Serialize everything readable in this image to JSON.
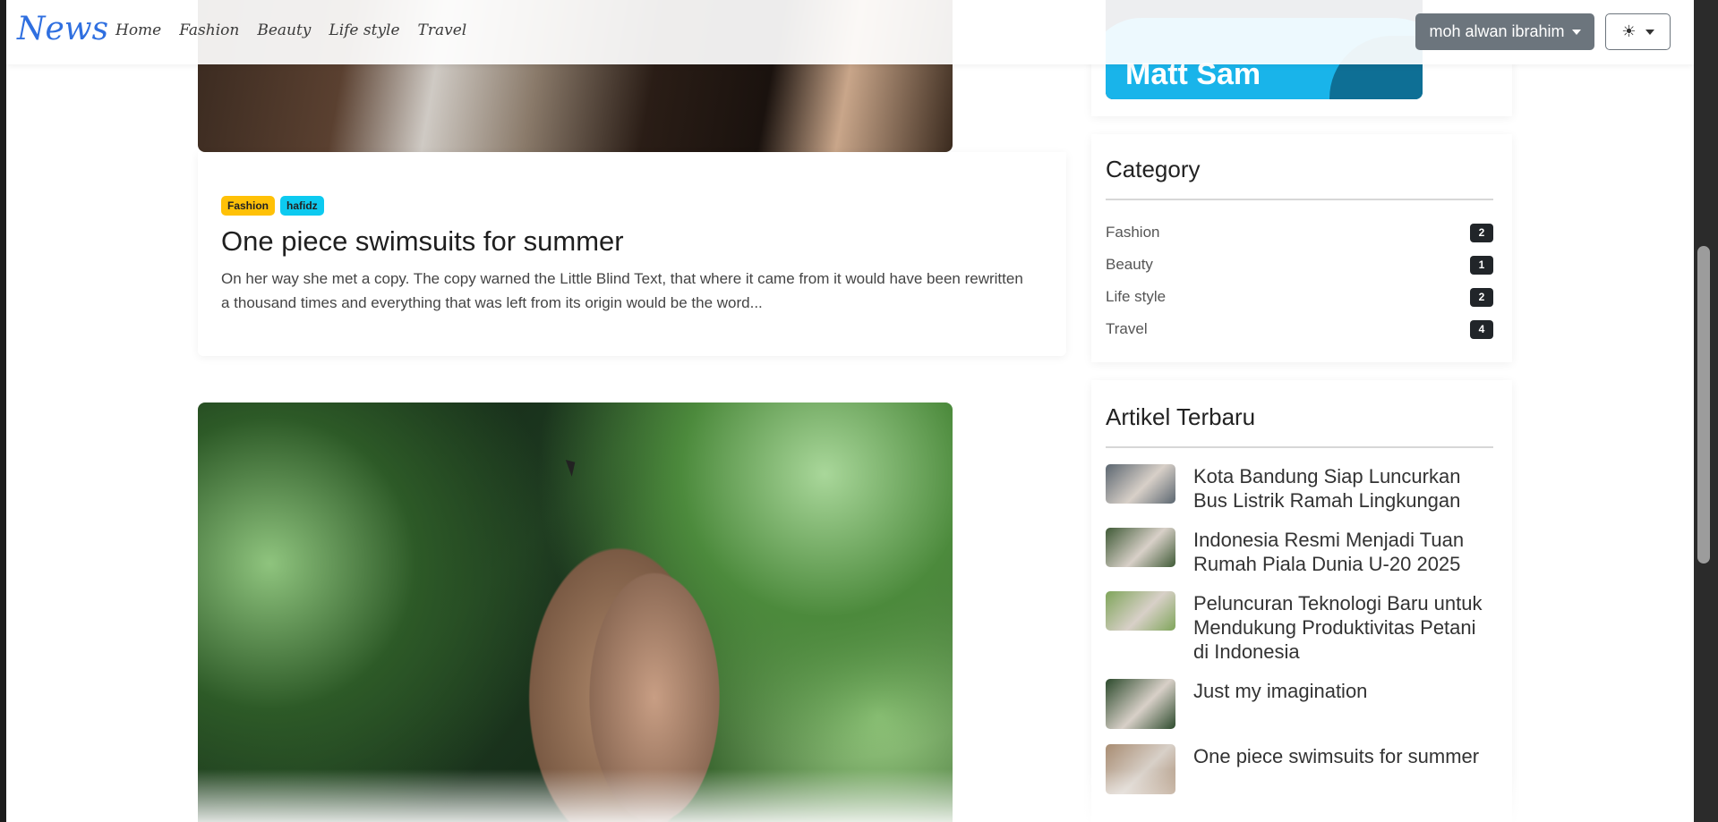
{
  "navbar": {
    "brand": "News",
    "links": [
      "Home",
      "Fashion",
      "Beauty",
      "Life style",
      "Travel"
    ],
    "user_label": "moh alwan ibrahim",
    "theme_icon": "sun-icon"
  },
  "sidebar": {
    "author_banner_name": "Matt Sam",
    "category": {
      "title": "Category",
      "items": [
        {
          "name": "Fashion",
          "count": "2"
        },
        {
          "name": "Beauty",
          "count": "1"
        },
        {
          "name": "Life style",
          "count": "2"
        },
        {
          "name": "Travel",
          "count": "4"
        }
      ]
    },
    "latest": {
      "title": "Artikel Terbaru",
      "items": [
        {
          "title": "Kota Bandung Siap Luncurkan Bus Listrik Ramah Lingkungan",
          "thumb_color": "#5b6670"
        },
        {
          "title": "Indonesia Resmi Menjadi Tuan Rumah Piala Dunia U-20 2025",
          "thumb_color": "#3f5a36"
        },
        {
          "title": "Peluncuran Teknologi Baru untuk Mendukung Produktivitas Petani di Indonesia",
          "thumb_color": "#7fa55a"
        },
        {
          "title": "Just my imagination",
          "thumb_color": "#2c4a2c"
        },
        {
          "title": "One piece swimsuits for summer",
          "thumb_color": "#a88c72"
        }
      ]
    }
  },
  "main": {
    "post": {
      "badges": [
        {
          "label": "Fashion",
          "color": "#ffc107"
        },
        {
          "label": "hafidz",
          "color": "#0dcaf0"
        }
      ],
      "title": "One piece swimsuits for summer",
      "excerpt": "On her way she met a copy. The copy warned the Little Blind Text, that where it came from it would have been rewritten a thousand times and everything that was left from its origin would be the word..."
    }
  }
}
